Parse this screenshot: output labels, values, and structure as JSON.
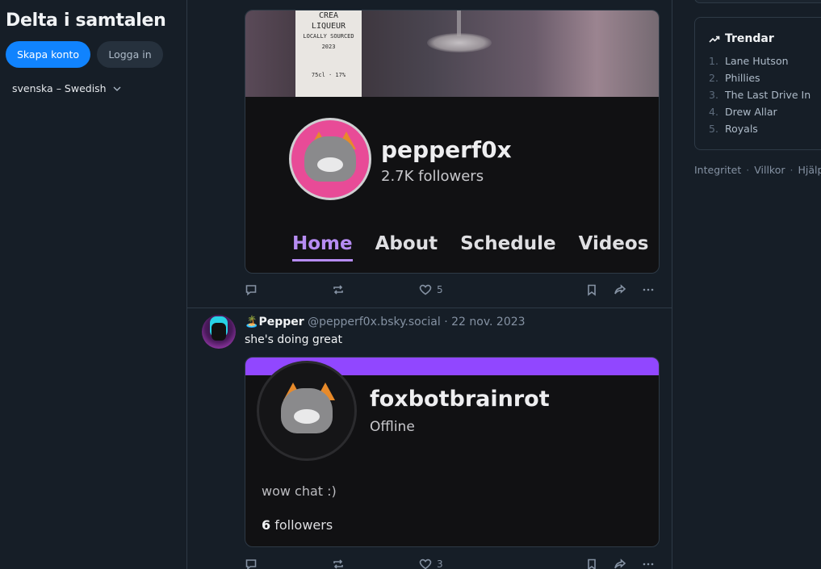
{
  "sidebar": {
    "heading": "Delta i samtalen",
    "create_account": "Skapa konto",
    "login": "Logga in",
    "language": "svenska – Swedish"
  },
  "post1": {
    "embed": {
      "bottle_text": [
        "CREA",
        "LIQUEUR",
        "LOCALLY SOURCED",
        "2023",
        "",
        "75cl · 17%"
      ],
      "channel_name": "pepperf0x",
      "followers": "2.7K followers",
      "tabs": [
        "Home",
        "About",
        "Schedule",
        "Videos"
      ],
      "active_tab": "Home"
    },
    "likes": "5"
  },
  "post2": {
    "author_emoji": "🏝️",
    "author_name": "Pepper",
    "handle": "@pepperf0x.bsky.social",
    "separator": "·",
    "date": "22 nov. 2023",
    "text": "she's doing great",
    "embed": {
      "channel_name": "foxbotbrainrot",
      "status": "Offline",
      "bio": "wow chat :)",
      "followers_count": "6",
      "followers_label": "followers",
      "accent_color": "#9147ff"
    },
    "likes": "3"
  },
  "trending": {
    "title": "Trendar",
    "items": [
      {
        "num": "1.",
        "label": "Lane Hutson"
      },
      {
        "num": "2.",
        "label": "Phillies"
      },
      {
        "num": "3.",
        "label": "The Last Drive In"
      },
      {
        "num": "4.",
        "label": "Drew Allar"
      },
      {
        "num": "5.",
        "label": "Royals"
      }
    ]
  },
  "footer": {
    "privacy": "Integritet",
    "terms": "Villkor",
    "help": "Hjälp",
    "sep": "·"
  },
  "icons": [
    "reply-icon",
    "repost-icon",
    "like-icon",
    "bookmark-icon",
    "share-icon",
    "more-icon",
    "trending-icon",
    "chevron-down-icon"
  ]
}
